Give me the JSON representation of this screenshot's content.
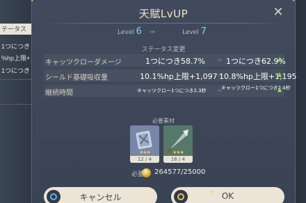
{
  "background": {
    "rows": [
      "テータス",
      "1つにつき",
      "%hp上限+",
      "1つにつき"
    ]
  },
  "dialog": {
    "title": "天賦LvUP",
    "close_glyph": "✕",
    "level": {
      "label": "Level",
      "current": "6",
      "next": "7"
    },
    "stats_section_label": "ステータス変更",
    "stats": [
      {
        "name": "キャッツクローダメージ",
        "current": "1つにつき58.7%",
        "next": "1つにつき62.9%"
      },
      {
        "name": "シールド基礎吸収量",
        "current": "10.1%hp上限+1,097",
        "next": "10.8%hp上限+1,195"
      },
      {
        "name": "継続時間",
        "current": "キャッツクロー1つにつき2.3秒",
        "next": "キャッツクロー1つにつき2.4秒"
      }
    ],
    "materials_label": "必要素材",
    "materials": [
      {
        "count": "12 / 4",
        "stars": "★★★",
        "icon": "talent-book-icon"
      },
      {
        "count": "16 / 4",
        "stars": "★★★",
        "icon": "arrowhead-icon"
      }
    ],
    "cost": {
      "label": "必要",
      "value": "264577/25000",
      "icon": "mora-coin-icon"
    },
    "buttons": {
      "cancel": "キャンセル",
      "ok": "OK"
    }
  },
  "colors": {
    "accent_level": "#7fd3f0",
    "up_arrow": "#8fd640",
    "star": "#f0c94a"
  }
}
